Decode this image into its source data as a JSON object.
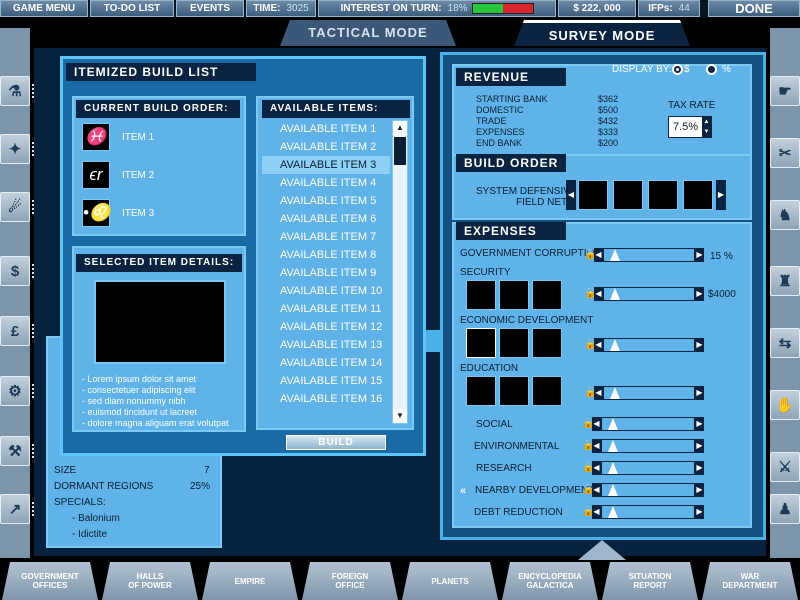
{
  "topbar": {
    "game_menu": "GAME MENU",
    "todo": "TO-DO LIST",
    "events": "EVENTS",
    "time_label": "TIME:",
    "time_value": "3025",
    "interest_label": "INTEREST ON TURN:",
    "interest_value": "18%",
    "interest_fraction": 0.5,
    "money": "$ 222, 000",
    "ifps_label": "IFPs:",
    "ifps_value": "44",
    "done": "DONE"
  },
  "modes": {
    "tactical": "TACTICAL MODE",
    "survey": "SURVEY MODE"
  },
  "build_list": {
    "title": "ITEMIZED BUILD LIST",
    "current_order_title": "CURRENT BUILD ORDER:",
    "current_items": [
      {
        "label": "ITEM 1",
        "glyph": "♓",
        "icon": "pisces-icon"
      },
      {
        "label": "ITEM 2",
        "glyph": "ϵr",
        "icon": "script-glyph-icon"
      },
      {
        "label": "ITEM 3",
        "glyph": "•♌",
        "icon": "leo-icon"
      }
    ],
    "available_title": "AVAILABLE ITEMS:",
    "available_items": [
      "AVAILABLE ITEM 1",
      "AVAILABLE ITEM 2",
      "AVAILABLE ITEM 3",
      "AVAILABLE ITEM 4",
      "AVAILABLE ITEM 5",
      "AVAILABLE ITEM 6",
      "AVAILABLE ITEM 7",
      "AVAILABLE ITEM 8",
      "AVAILABLE ITEM 9",
      "AVAILABLE ITEM 10",
      "AVAILABLE ITEM 11",
      "AVAILABLE ITEM 12",
      "AVAILABLE ITEM 13",
      "AVAILABLE ITEM 14",
      "AVAILABLE ITEM 15",
      "AVAILABLE ITEM 16"
    ],
    "selected_index": 2,
    "details_title": "SELECTED ITEM DETAILS:",
    "details_lines": [
      "- Lorem ipsum dolor sit amet",
      "- consectetuer adipiscing elit",
      "- sed diam nonummy nibh",
      "- euismod tincidunt ut lacreet",
      "- dolore magna aliguam erat volutpat"
    ],
    "build_button": "BUILD"
  },
  "planet_info": {
    "size_label": "SIZE",
    "size_value": "7",
    "dormant_label": "DORMANT REGIONS",
    "dormant_value": "25%",
    "specials_label": "SPECIALS:",
    "specials": [
      "- Balonium",
      "- Idictite"
    ]
  },
  "survey": {
    "revenue_title": "REVENUE",
    "display_by_label": "DISPLAY BY:",
    "display_dollar": "$",
    "display_percent": "%",
    "revenue_rows": [
      {
        "label": "STARTING BANK",
        "value": "$362"
      },
      {
        "label": "DOMESTIC",
        "value": "$500"
      },
      {
        "label": "TRADE",
        "value": "$432"
      },
      {
        "label": "EXPENSES",
        "value": "$333"
      },
      {
        "label": "END BANK",
        "value": "$200"
      }
    ],
    "tax_rate_label": "TAX RATE",
    "tax_rate_value": "7.5%",
    "build_order_title": "BUILD ORDER",
    "build_order_label_1": "SYSTEM DEFENSIVE",
    "build_order_label_2": "FIELD NET",
    "expenses_title": "EXPENSES",
    "gov_corruption": "GOVERNMENT CORRUPTION",
    "gov_corruption_value": "15 %",
    "security": "SECURITY",
    "security_value": "$4000",
    "economic": "ECONOMIC DEVELOPMENT",
    "education": "EDUCATION",
    "social": "SOCIAL",
    "environmental": "ENVIRONMENTAL",
    "research": "RESEARCH",
    "nearby": "NEARBY DEVELOPMENT",
    "debt": "DEBT REDUCTION"
  },
  "bottom_tabs": [
    {
      "l1": "GOVERNMENT",
      "l2": "OFFICES"
    },
    {
      "l1": "HALLS",
      "l2": "OF POWER"
    },
    {
      "l1": "EMPIRE",
      "l2": ""
    },
    {
      "l1": "FOREIGN",
      "l2": "OFFICE"
    },
    {
      "l1": "PLANETS",
      "l2": ""
    },
    {
      "l1": "ENCYCLOPEDIA",
      "l2": "GALACTICA"
    },
    {
      "l1": "SITUATION",
      "l2": "REPORT"
    },
    {
      "l1": "WAR",
      "l2": "DEPARTMENT"
    }
  ],
  "left_side_icons": [
    {
      "glyph": "⚗",
      "icon": "flask-icon"
    },
    {
      "glyph": "✦",
      "icon": "shield-icon"
    },
    {
      "glyph": "☄",
      "icon": "dragon-icon"
    },
    {
      "glyph": "$",
      "icon": "dollar-icon"
    },
    {
      "glyph": "£",
      "icon": "pound-icon"
    },
    {
      "glyph": "⚙",
      "icon": "gears-icon"
    },
    {
      "glyph": "⚒",
      "icon": "tools-icon"
    },
    {
      "glyph": "↗",
      "icon": "chart-icon"
    }
  ],
  "right_side_icons": [
    {
      "glyph": "☛",
      "icon": "hand-icon"
    },
    {
      "glyph": "✂",
      "icon": "wrench-icon"
    },
    {
      "glyph": "♞",
      "icon": "creature-icon"
    },
    {
      "glyph": "♜",
      "icon": "tower-icon"
    },
    {
      "glyph": "⇆",
      "icon": "arrows-icon"
    },
    {
      "glyph": "✋",
      "icon": "palm-icon"
    },
    {
      "glyph": "⚔",
      "icon": "sword-icon"
    },
    {
      "glyph": "♟",
      "icon": "figure-icon"
    }
  ]
}
